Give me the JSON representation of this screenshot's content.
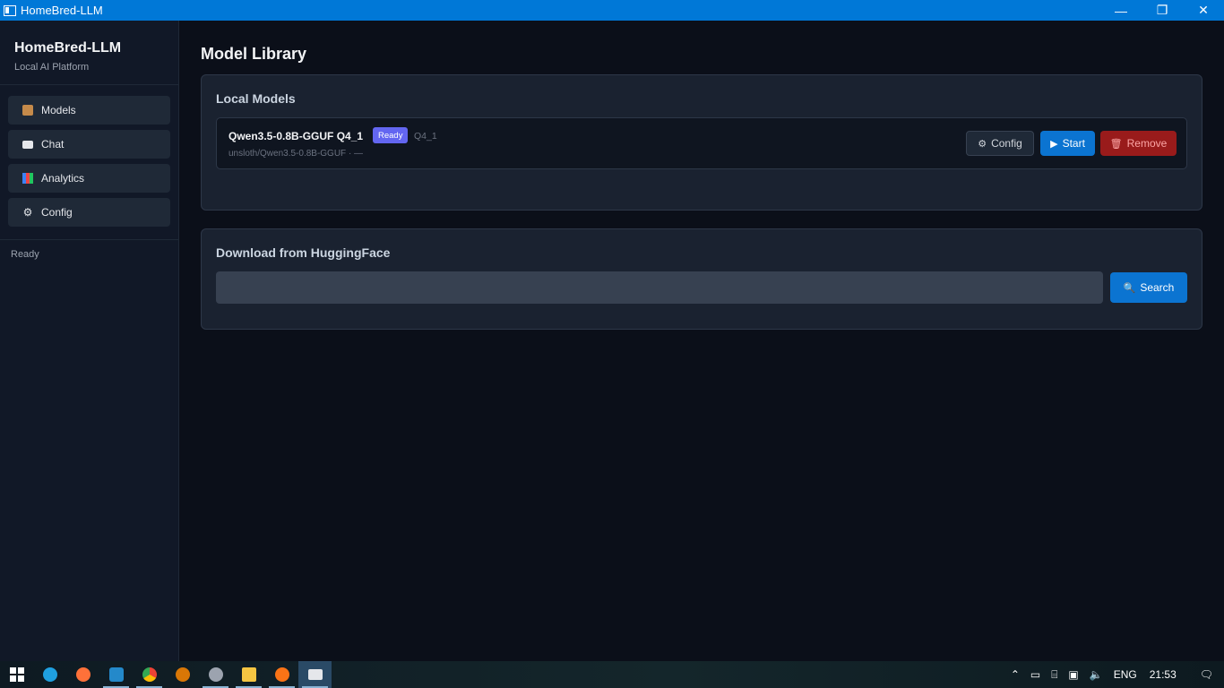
{
  "window": {
    "title": "HomeBred-LLM",
    "minimize": "—",
    "maximize": "❐",
    "close": "✕"
  },
  "sidebar": {
    "brand": "HomeBred-LLM",
    "subtitle": "Local AI Platform",
    "items": [
      {
        "label": "Models",
        "icon": "box-icon"
      },
      {
        "label": "Chat",
        "icon": "chat-icon"
      },
      {
        "label": "Analytics",
        "icon": "chart-icon"
      },
      {
        "label": "Config",
        "icon": "gear-icon"
      }
    ],
    "status": "Ready"
  },
  "main": {
    "title": "Model Library",
    "local_models": {
      "heading": "Local Models",
      "models": [
        {
          "name": "Qwen3.5-0.8B-GGUF Q4_1",
          "badge": "Ready",
          "quant": "Q4_1",
          "path": "unsloth/Qwen3.5-0.8B-GGUF · —",
          "buttons": {
            "config": "Config",
            "start": "Start",
            "remove": "Remove"
          }
        }
      ]
    },
    "download": {
      "heading": "Download from HuggingFace",
      "search_value": "",
      "search_placeholder": "",
      "search_button": "Search"
    }
  },
  "taskbar": {
    "language": "ENG",
    "time": "21:53"
  }
}
